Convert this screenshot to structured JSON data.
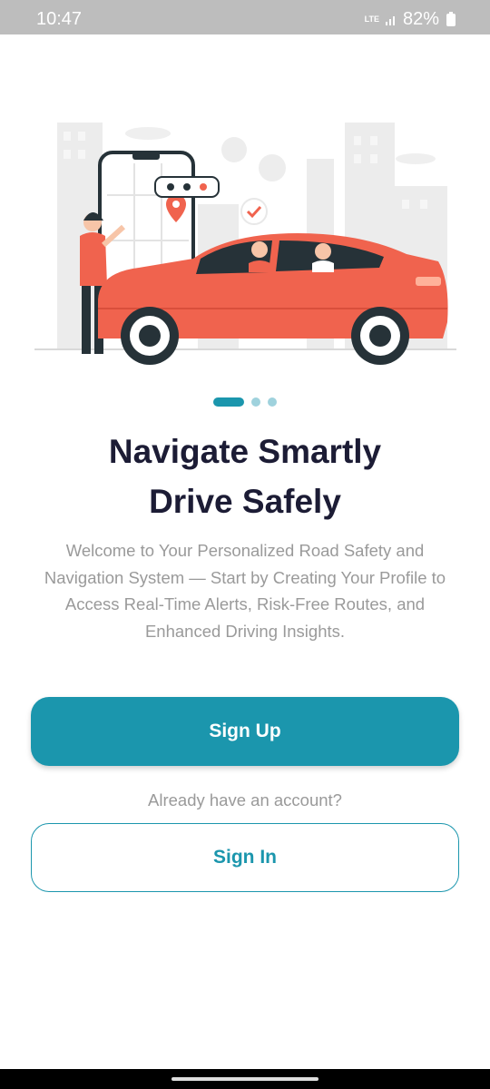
{
  "status_bar": {
    "time": "10:47",
    "network": "LTE",
    "battery": "82%"
  },
  "onboarding": {
    "illustration_icon": "car-ride-illustration",
    "page_count": 3,
    "current_page": 1,
    "title_line1": "Navigate Smartly",
    "title_line2": "Drive Safely",
    "description": "Welcome to Your Personalized Road Safety and Navigation System — Start by Creating Your Profile to Access Real-Time Alerts, Risk-Free Routes, and Enhanced Driving Insights."
  },
  "actions": {
    "sign_up_label": "Sign Up",
    "account_prompt": "Already have an account?",
    "sign_in_label": "Sign In"
  },
  "colors": {
    "accent": "#1b96ad",
    "car": "#f0634e",
    "heading": "#1c1c35",
    "muted": "#9a9a9a"
  }
}
